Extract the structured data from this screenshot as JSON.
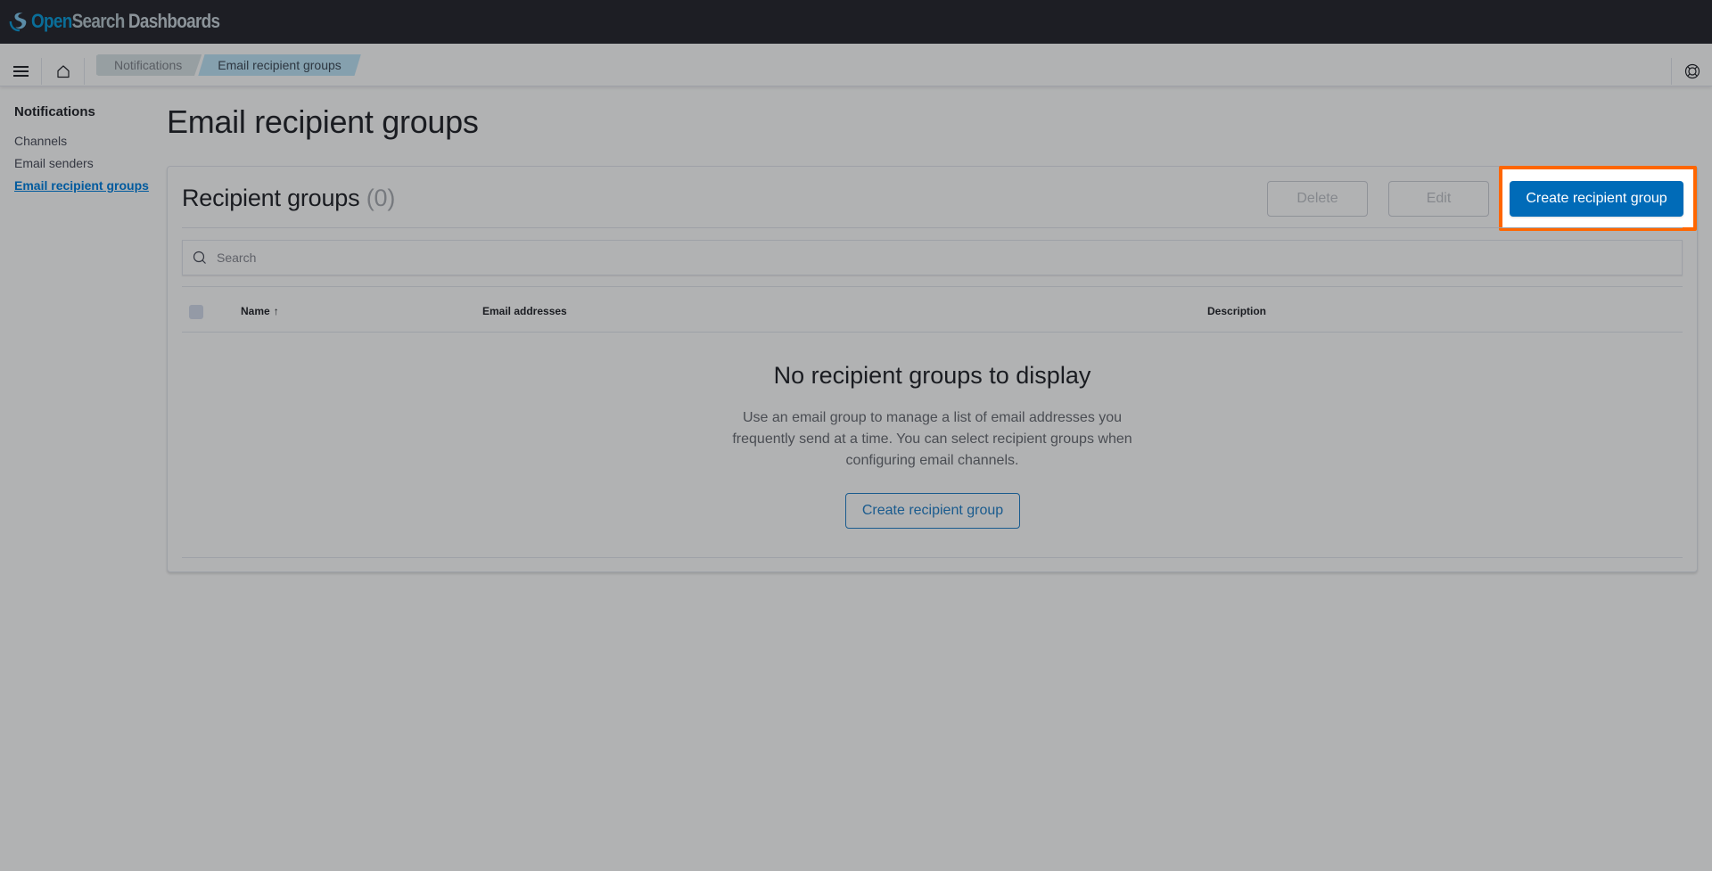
{
  "header": {
    "logo_open": "Open",
    "logo_search": "Search",
    "logo_dashboards": "Dashboards"
  },
  "navbar": {
    "menu_icon": "hamburger-menu-icon",
    "home_icon": "home-icon",
    "help_icon": "help-lifebuoy-icon",
    "breadcrumbs": [
      {
        "label": "Notifications"
      },
      {
        "label": "Email recipient groups"
      }
    ]
  },
  "sidebar": {
    "title": "Notifications",
    "items": [
      {
        "label": "Channels",
        "active": false
      },
      {
        "label": "Email senders",
        "active": false
      },
      {
        "label": "Email recipient groups",
        "active": true
      }
    ]
  },
  "page": {
    "title": "Email recipient groups"
  },
  "panel": {
    "title": "Recipient groups",
    "count": "(0)",
    "delete_label": "Delete",
    "edit_label": "Edit",
    "create_label": "Create recipient group",
    "search_placeholder": "Search",
    "search_value": "",
    "columns": [
      {
        "label": "Name",
        "sort": "ascending"
      },
      {
        "label": "Email addresses"
      },
      {
        "label": "Description"
      }
    ],
    "empty": {
      "title": "No recipient groups to display",
      "body": "Use an email group to manage a list of email addresses you frequently send at a time. You can select recipient groups when configuring email channels.",
      "button_label": "Create recipient group"
    }
  },
  "colors": {
    "primary": "#006bb8",
    "highlight": "#ff6600",
    "topbar": "#1d1e24",
    "overlay_bg": "#b1b2b3"
  }
}
